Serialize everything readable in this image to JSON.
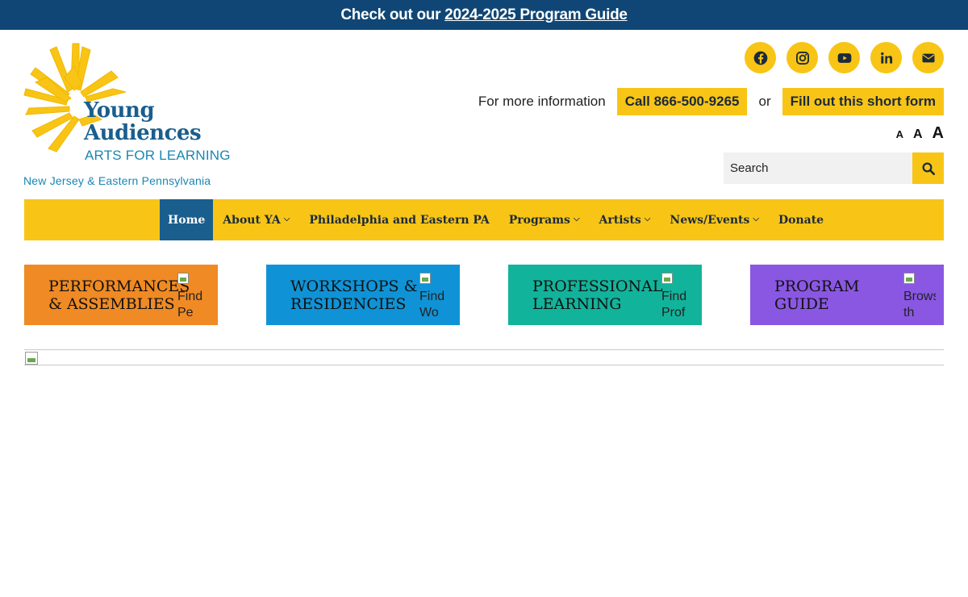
{
  "banner": {
    "text": "Check out our",
    "link": "2024-2025 Program Guide"
  },
  "logo": {
    "line1": "Young",
    "line2": "Audiences",
    "tagline": "ARTS FOR LEARNING",
    "region": "New Jersey & Eastern Pennsylvania"
  },
  "social": [
    "facebook-icon",
    "instagram-icon",
    "youtube-icon",
    "linkedin-icon",
    "envelope-icon"
  ],
  "info": {
    "label": "For more information",
    "call": "Call 866-500-9265",
    "or": "or",
    "form": "Fill out this short form"
  },
  "fontsize": {
    "small": "A",
    "medium": "A",
    "large": "A"
  },
  "search": {
    "placeholder": "Search"
  },
  "nav": [
    {
      "label": "Home",
      "active": true,
      "dropdown": false
    },
    {
      "label": "About YA",
      "dropdown": true
    },
    {
      "label": "Philadelphia and Eastern PA",
      "dropdown": false
    },
    {
      "label": "Programs",
      "dropdown": true
    },
    {
      "label": "Artists",
      "dropdown": true
    },
    {
      "label": "News/Events",
      "dropdown": true
    },
    {
      "label": "Donate",
      "dropdown": false
    }
  ],
  "tiles": [
    {
      "title": "PERFORMANCES & ASSEMBLIES",
      "alt": "Find Pe",
      "color": "#ef8a24"
    },
    {
      "title": "WORKSHOPS & RESIDENCIES",
      "alt": "Find Wo",
      "color": "#0f93d6"
    },
    {
      "title": "PROFESSIONAL LEARNING",
      "alt": "Find Prof",
      "color": "#12b39b"
    },
    {
      "title": "PROGRAM GUIDE",
      "alt": "Brows th",
      "color": "#8a57e3"
    }
  ],
  "colors": {
    "navy": "#0f4675",
    "yellow": "#f8c516",
    "blue": "#1a5e8e"
  }
}
